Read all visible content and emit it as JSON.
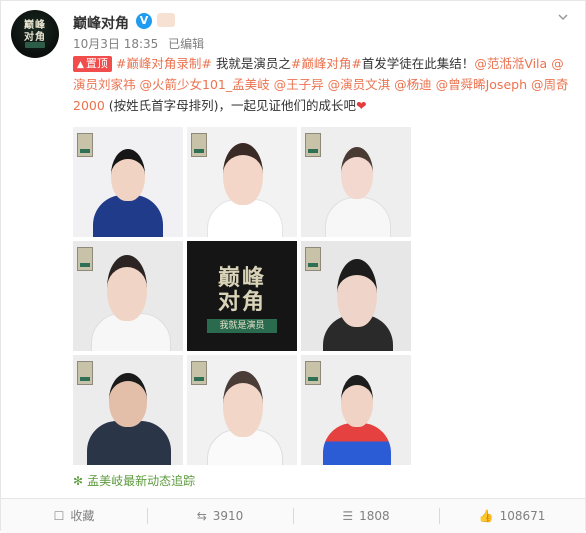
{
  "header": {
    "username": "巅峰对角",
    "verified_icon": "verified-v-icon",
    "date": "10月3日 18:35",
    "edited": "已编辑",
    "avatar_text_top": "巅峰",
    "avatar_text_bottom": "对角"
  },
  "post": {
    "pin_label": "置顶",
    "line_parts": [
      {
        "t": "#巅峰对角录制#",
        "k": "link"
      },
      {
        "t": " 我就是演员之",
        "k": "text"
      },
      {
        "t": "#巅峰对角#",
        "k": "link"
      },
      {
        "t": "首发学徒在此集结！",
        "k": "text"
      },
      {
        "t": "@范湉湉Vila",
        "k": "at"
      },
      {
        "t": " ",
        "k": "text"
      },
      {
        "t": "@演员刘家祎",
        "k": "at"
      },
      {
        "t": " ",
        "k": "text"
      },
      {
        "t": "@火箭少女101_孟美岐",
        "k": "at"
      },
      {
        "t": " ",
        "k": "text"
      },
      {
        "t": "@王子异",
        "k": "at"
      },
      {
        "t": " ",
        "k": "text"
      },
      {
        "t": "@演员文淇",
        "k": "at"
      },
      {
        "t": " ",
        "k": "text"
      },
      {
        "t": "@杨迪",
        "k": "at"
      },
      {
        "t": " ",
        "k": "text"
      },
      {
        "t": "@曾舜晞Joseph",
        "k": "at"
      },
      {
        "t": " ",
        "k": "text"
      },
      {
        "t": "@周奇2000",
        "k": "at"
      },
      {
        "t": "  (按姓氏首字母排列)，一起见证他们的成长吧",
        "k": "text"
      },
      {
        "t": "❤",
        "k": "heart"
      }
    ]
  },
  "grid": {
    "center_title_top": "巅峰",
    "center_title_bottom": "对角",
    "center_subtitle": "我就是演员"
  },
  "follow_link": "孟美岐最新动态追踪",
  "actions": [
    {
      "label": "收藏",
      "icon": "favorite-icon"
    },
    {
      "label": "3910",
      "icon": "repost-icon"
    },
    {
      "label": "1808",
      "icon": "comment-icon"
    },
    {
      "label": "108671",
      "icon": "like-icon"
    }
  ],
  "colors": {
    "link": "#eb7350",
    "pin": "#f24d4d",
    "verify": "#1e9cf1",
    "follow": "#5c9b3d"
  }
}
